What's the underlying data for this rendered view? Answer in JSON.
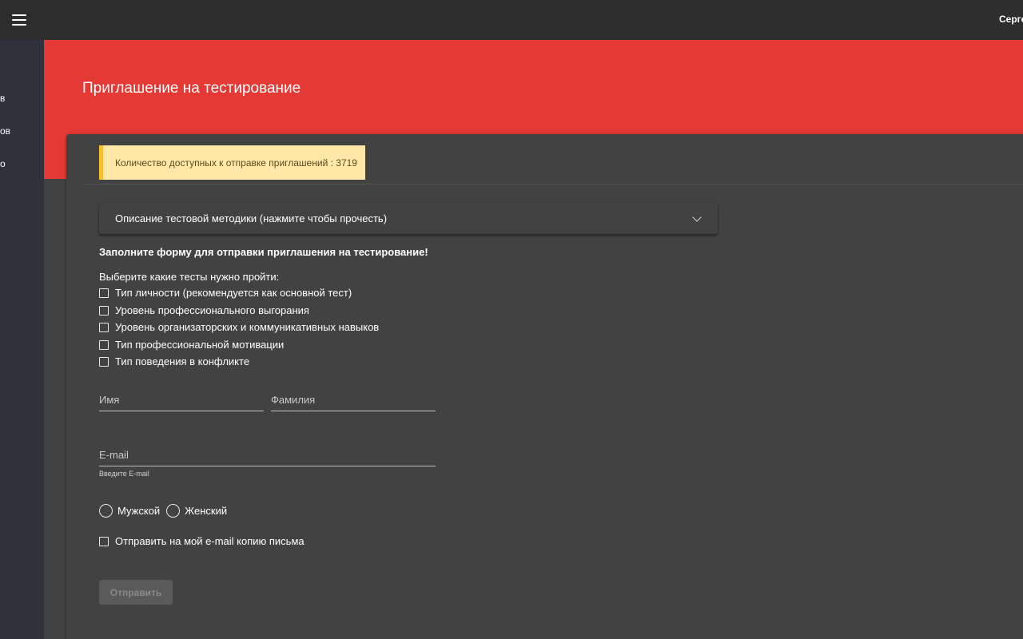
{
  "sidebar": {
    "items": [
      {
        "label": "в"
      },
      {
        "label": "ов"
      },
      {
        "label": "о"
      }
    ]
  },
  "header": {
    "user_name": "Серге"
  },
  "page": {
    "title": "Приглашение на тестирование"
  },
  "alert": {
    "text": "Количество доступных к отправке приглашений : 3719"
  },
  "expander": {
    "label": "Описание тестовой методики (нажмите чтобы прочесть)"
  },
  "form": {
    "heading": "Заполните форму для отправки приглашения на тестирование!",
    "tests_label": "Выберите какие тесты нужно пройти:",
    "tests": [
      {
        "label": "Тип личности (рекомендуется как основной тест)",
        "checked": false
      },
      {
        "label": "Уровень профессионального выгорания",
        "checked": false
      },
      {
        "label": "Уровень организаторских и коммуникативных навыков",
        "checked": false
      },
      {
        "label": "Тип профессиональной мотивации",
        "checked": false
      },
      {
        "label": "Тип поведения в конфликте",
        "checked": false
      }
    ],
    "first_name": {
      "value": "",
      "placeholder": "Имя"
    },
    "last_name": {
      "value": "",
      "placeholder": "Фамилия"
    },
    "email": {
      "value": "",
      "placeholder": "E-mail",
      "helper": "Введите E-mail"
    },
    "gender": {
      "male": "Мужской",
      "female": "Женский"
    },
    "copy_label": "Отправить на мой e-mail копию письма",
    "submit_label": "Отправить"
  }
}
